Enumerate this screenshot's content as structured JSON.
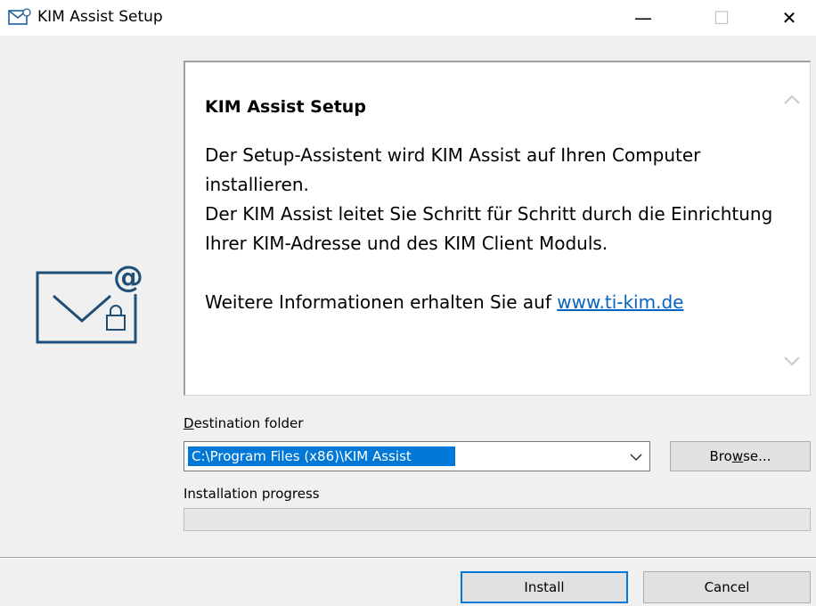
{
  "window": {
    "title": "KIM Assist Setup",
    "icon": "envelope-icon",
    "minimize_glyph": "—",
    "maximize_glyph": "☐",
    "close_glyph": "✕"
  },
  "info": {
    "heading": "KIM Assist Setup",
    "paragraph1": "Der Setup-Assistent wird KIM Assist auf Ihren Computer installieren.",
    "paragraph2": "Der KIM Assist leitet Sie Schritt für Schritt durch die Einrichtung Ihrer KIM-Adresse und des KIM Client Moduls.",
    "more_info_text": "Weitere Informationen erhalten Sie auf ",
    "link_text": "www.ti-kim.de"
  },
  "destination": {
    "label_prefix": "",
    "label_underlined": "D",
    "label_rest": "estination folder",
    "value": "C:\\Program Files (x86)\\KIM Assist",
    "browse_prefix": "Bro",
    "browse_underlined": "w",
    "browse_rest": "se..."
  },
  "progress": {
    "label": "Installation progress",
    "fraction": 0
  },
  "buttons": {
    "install": "Install",
    "cancel": "Cancel"
  },
  "colors": {
    "accent": "#0078d7",
    "link": "#0563c1",
    "logo": "#1f4e79"
  }
}
